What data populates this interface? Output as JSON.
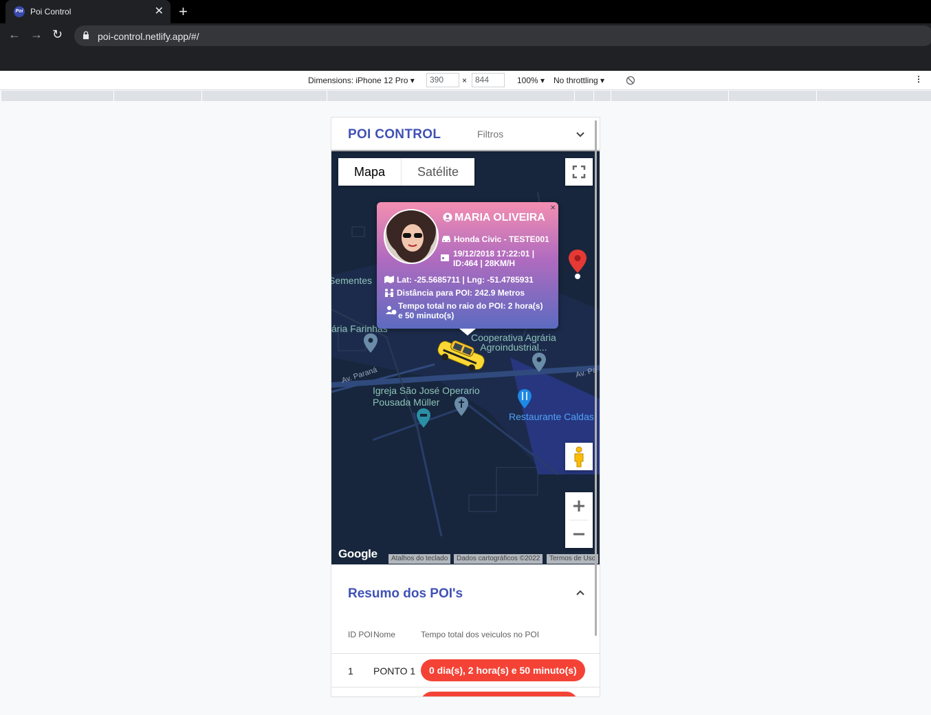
{
  "browser": {
    "tab_title": "Poi Control",
    "favicon_text": "Poi",
    "url": "poi-control.netlify.app/#/"
  },
  "devtools": {
    "dimensions_label": "Dimensions: iPhone 12 Pro",
    "width": "390",
    "height": "844",
    "times": "×",
    "zoom": "100%",
    "throttling": "No throttling"
  },
  "app": {
    "brand": "POI CONTROL",
    "filters_label": "Filtros"
  },
  "map": {
    "map_type_options": [
      "Mapa",
      "Satélite"
    ],
    "selected_map_type": "Mapa",
    "labels": {
      "sementes": "Sementes",
      "agraria": "ária Farinhas",
      "cooperativa": "Cooperativa Agrária\nAgroindustrial...",
      "igreja": "Igreja São José Operario",
      "pousada": "Pousada Müller",
      "restaurante": "Restaurante Caldas",
      "road1": "Av. Paraná",
      "road2": "Av. Pa"
    },
    "google": "Google",
    "attributions": [
      "Atalhos do teclado",
      "Dados cartográficos ©2022",
      "Termos de Uso"
    ]
  },
  "info_window": {
    "name": "MARIA OLIVEIRA",
    "vehicle": "Honda Civic - TESTE001",
    "datetime_line1": "19/12/2018 17:22:01 |",
    "datetime_line2": "ID:464 | 28KM/H",
    "coords": "Lat: -25.5685711 | Lng: -51.4785931",
    "distance": "Distância para POI: 242.9 Metros",
    "time_line1": "Tempo total no raio do POI: 2 hora(s)",
    "time_line2": "e 50 minuto(s)",
    "close_symbol": "×"
  },
  "summary": {
    "title": "Resumo dos POI's",
    "columns": [
      "ID POI",
      "Nome",
      "Tempo total dos veiculos no POI"
    ],
    "rows": [
      {
        "id": "1",
        "name": "PONTO 1",
        "time": "0 dia(s), 2 hora(s) e 50 minuto(s)"
      }
    ]
  },
  "colors": {
    "accent": "#3f51b5",
    "chip": "#f44336",
    "map_bg": "#17263c"
  }
}
